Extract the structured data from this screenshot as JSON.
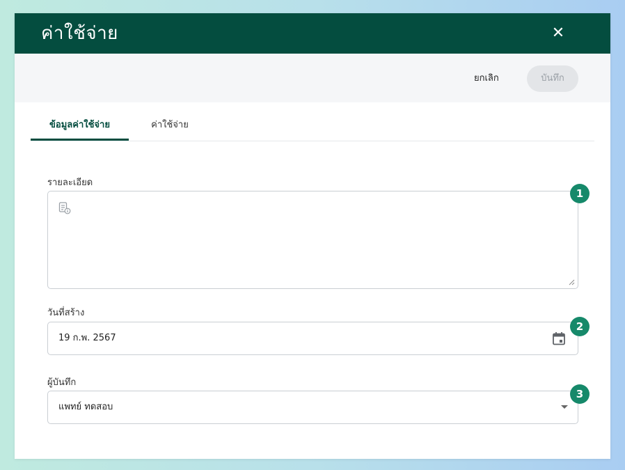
{
  "dialog": {
    "title": "ค่าใช้จ่าย",
    "close_icon": "close-icon",
    "cancel_label": "ยกเลิก",
    "save_label": "บันทึก",
    "tabs": [
      {
        "label": "ข้อมูลค่าใช้จ่าย",
        "active": true
      },
      {
        "label": "ค่าใช้จ่าย",
        "active": false
      }
    ],
    "fields": {
      "details": {
        "label": "รายละเอียด",
        "value": "",
        "icon": "document-info-icon"
      },
      "created_date": {
        "label": "วันที่สร้าง",
        "value": "19 ก.พ. 2567",
        "icon": "calendar-icon"
      },
      "recorder": {
        "label": "ผู้บันทึก",
        "value": "แพทย์ ทดสอบ",
        "icon": "caret-down-icon"
      }
    }
  },
  "badges": [
    "1",
    "2",
    "3"
  ],
  "colors": {
    "header": "#044d3f",
    "badge": "#16896a",
    "save_disabled_bg": "#e3e5e8",
    "toolbar_bg": "#f5f6f8"
  }
}
